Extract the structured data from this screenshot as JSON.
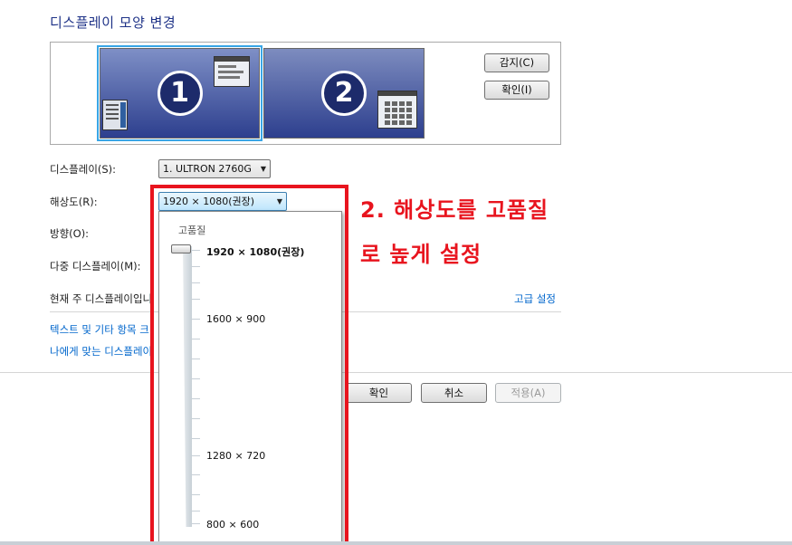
{
  "page": {
    "title": "디스플레이 모양 변경"
  },
  "monitors": [
    {
      "number": "1"
    },
    {
      "number": "2"
    }
  ],
  "side_buttons": {
    "detect": "감지(C)",
    "identify": "확인(I)"
  },
  "display": {
    "label": "디스플레이(S):",
    "value": "1. ULTRON 2760G"
  },
  "resolution": {
    "label": "해상도(R):",
    "value": "1920 × 1080(권장)",
    "dropdown": {
      "heading": "고품질",
      "options": [
        "1920 × 1080(권장)",
        "1600 × 900",
        "1280 × 720",
        "800 × 600"
      ],
      "selected": "1920 × 1080(권장)"
    }
  },
  "orientation": {
    "label": "방향(O):"
  },
  "multiple_displays": {
    "label": "다중 디스플레이(M):"
  },
  "primary_display": {
    "text": "현재 주 디스플레이입니"
  },
  "advanced_link": "고급 설정",
  "links": {
    "text_size": "텍스트 및 기타 항목 크",
    "which_display": "나에게 맞는 디스플레이"
  },
  "footer": {
    "ok": "확인",
    "cancel": "취소",
    "apply": "적용(A)"
  },
  "annotation": {
    "line1": "2. 해상도를 고품질",
    "line2": "로 높게 설정"
  },
  "colors": {
    "annotation": "#e8141e",
    "title": "#1e3287",
    "link": "#0066cc"
  }
}
